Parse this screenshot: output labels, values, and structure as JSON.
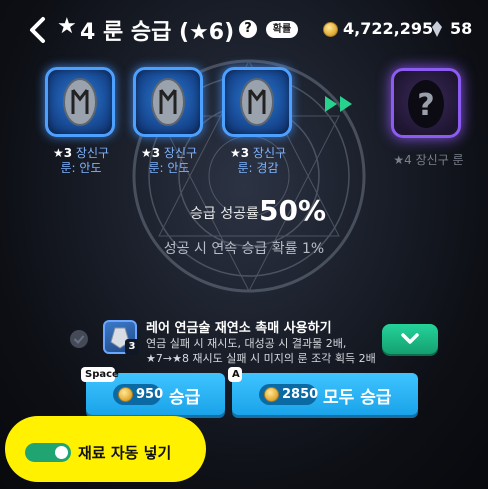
{
  "header": {
    "back_icon": "chevron-left-icon",
    "title_star": "★",
    "title": "4 룬 승급 (★6)",
    "help_label": "?",
    "prob_badge": "확률",
    "gold": "4,722,295",
    "gem": "58"
  },
  "runes": [
    {
      "star": "★3",
      "line1": "장신구",
      "line2": "룬: 안도"
    },
    {
      "star": "★3",
      "line1": "장신구",
      "line2": "룬: 안도"
    },
    {
      "star": "★3",
      "line1": "장신구",
      "line2": "룬: 경감"
    }
  ],
  "result": {
    "star": "★4",
    "label": "장신구 룬",
    "icon": "question-mark-icon"
  },
  "rate": {
    "label": "승급 성공률",
    "value": "50%",
    "sub": "성공 시 연속 승급 확률 1%"
  },
  "catalyst": {
    "title": "레어 연금술 재연소 촉매 사용하기",
    "count": "3",
    "desc1": "연금 실패 시 재시도, 대성공 시 결과물 2배,",
    "desc2": "★7→★8 재시도 실패 시 미지의 룬 조각 획득 2배"
  },
  "buttons": {
    "upgrade": {
      "key": "Space",
      "cost": "950",
      "label": "승급"
    },
    "upgrade_all": {
      "key": "A",
      "cost": "2850",
      "label": "모두 승급"
    }
  },
  "auto_fill": {
    "label": "재료 자동 넣기",
    "enabled": true
  },
  "colors": {
    "accent": "#1aa3ea",
    "toggle_on": "#1fa472",
    "highlight": "#fff100"
  }
}
